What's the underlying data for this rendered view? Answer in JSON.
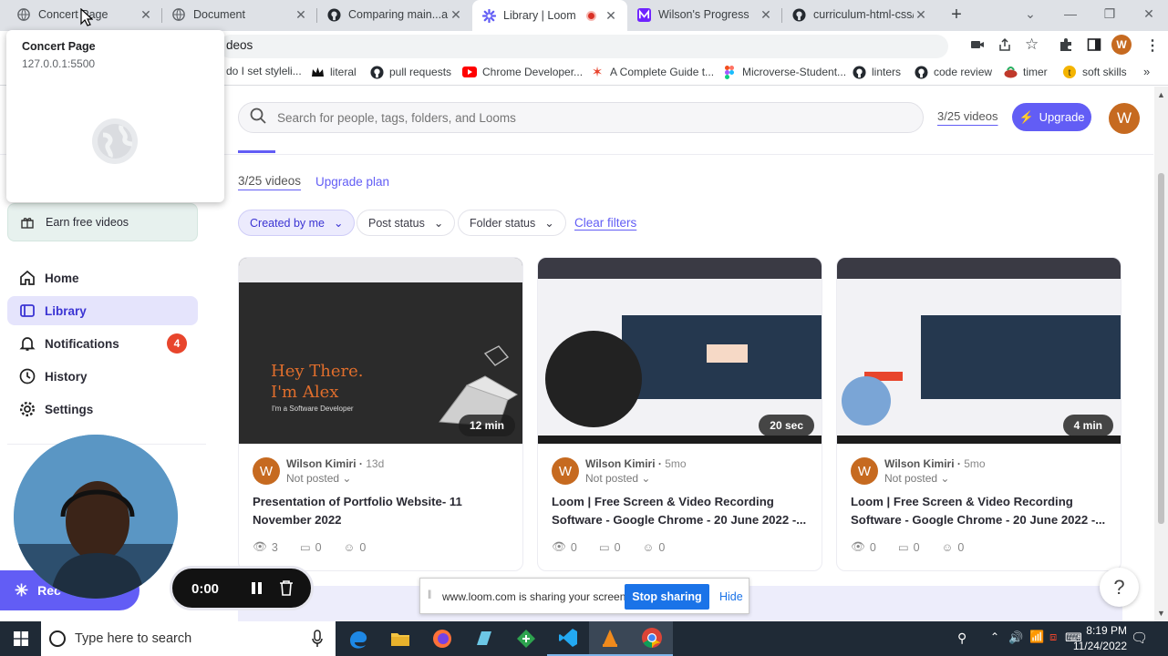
{
  "tabs": [
    {
      "title": "Concert Page",
      "active": false,
      "icon": "globe-icon"
    },
    {
      "title": "Document",
      "active": false,
      "icon": "globe-icon"
    },
    {
      "title": "Comparing main...abc",
      "active": false,
      "icon": "github-icon"
    },
    {
      "title": "Library | Loom",
      "active": true,
      "icon": "loom-icon"
    },
    {
      "title": "Wilson's Progress",
      "active": false,
      "icon": "microverse-icon"
    },
    {
      "title": "curriculum-html-css/h",
      "active": false,
      "icon": "github-icon"
    }
  ],
  "tooltip": {
    "title": "Concert Page",
    "url": "127.0.0.1:5500"
  },
  "address_partial": "deos",
  "profile_initial": "W",
  "bookmarks": [
    {
      "label": "do I set styleli...",
      "icon": "doc-icon"
    },
    {
      "label": "literal",
      "icon": "crown-icon"
    },
    {
      "label": "pull requests",
      "icon": "github-icon"
    },
    {
      "label": "Chrome Developer...",
      "icon": "youtube-icon"
    },
    {
      "label": "A Complete Guide t...",
      "icon": "star-icon"
    },
    {
      "label": "Microverse-Student...",
      "icon": "figma-icon"
    },
    {
      "label": "linters",
      "icon": "github-icon"
    },
    {
      "label": "code review",
      "icon": "github-icon"
    },
    {
      "label": "timer",
      "icon": "timer-icon"
    },
    {
      "label": "soft skills",
      "icon": "skills-icon"
    }
  ],
  "search": {
    "placeholder": "Search for people, tags, folders, and Looms"
  },
  "header": {
    "videos_count": "3/25 videos",
    "upgrade_label": "Upgrade",
    "avatar_initial": "W"
  },
  "library": {
    "videos_count": "3/25 videos",
    "upgrade_plan": "Upgrade plan"
  },
  "filters": [
    "Created by me",
    "Post status",
    "Folder status"
  ],
  "clear_filters": "Clear filters",
  "sidebar": {
    "earn": "Earn free videos",
    "items": [
      {
        "label": "Home",
        "icon": "home-icon"
      },
      {
        "label": "Library",
        "icon": "library-icon",
        "active": true
      },
      {
        "label": "Notifications",
        "icon": "bell-icon",
        "badge": "4"
      },
      {
        "label": "History",
        "icon": "clock-icon"
      },
      {
        "label": "Settings",
        "icon": "gear-icon"
      }
    ],
    "record_label": "Rec"
  },
  "recorder": {
    "time": "0:00"
  },
  "videos": [
    {
      "duration": "12 min",
      "author": "Wilson Kimiri",
      "ago": "13d",
      "status": "Not posted",
      "title": "Presentation of Portfolio Website- 11 November 2022",
      "views": "3",
      "comments": "0",
      "reactions": "0",
      "thumb_text1": "Hey There.",
      "thumb_text2": "I'm Alex",
      "thumb_text3": "I'm a Software Developer"
    },
    {
      "duration": "20 sec",
      "author": "Wilson Kimiri",
      "ago": "5mo",
      "status": "Not posted",
      "title": "Loom | Free Screen & Video Recording Software - Google Chrome - 20 June 2022 -...",
      "views": "0",
      "comments": "0",
      "reactions": "0"
    },
    {
      "duration": "4 min",
      "author": "Wilson Kimiri",
      "ago": "5mo",
      "status": "Not posted",
      "title": "Loom | Free Screen & Video Recording Software - Google Chrome - 20 June 2022 -...",
      "views": "0",
      "comments": "0",
      "reactions": "0"
    }
  ],
  "sharing_bar": {
    "message": "www.loom.com is sharing your screen.",
    "stop": "Stop sharing",
    "hide": "Hide"
  },
  "help": "?",
  "taskbar": {
    "search_placeholder": "Type here to search",
    "time": "8:19 PM",
    "date": "11/24/2022"
  },
  "colors": {
    "accent": "#625df5",
    "tab_bg": "#dee1e6",
    "taskbar": "#1f2a36",
    "avatar": "#c66a20"
  }
}
